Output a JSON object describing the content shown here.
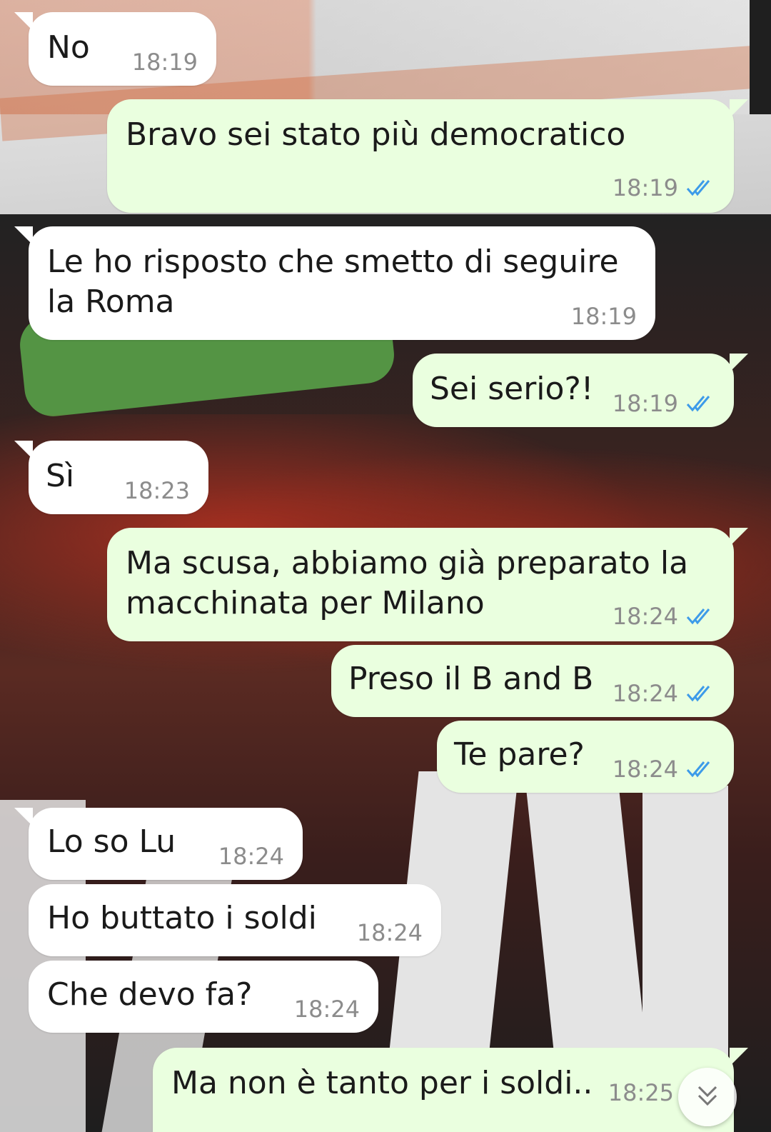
{
  "colors": {
    "incoming_bubble": "#ffffff",
    "outgoing_bubble": "#eaffdf",
    "read_ticks": "#3d9be9",
    "time_text": "#8c8c8c"
  },
  "icons": {
    "read_receipt": "double-check-icon",
    "scroll_down": "chevron-double-down-icon"
  },
  "messages": [
    {
      "dir": "in",
      "text": "No",
      "time": "18:19"
    },
    {
      "dir": "out",
      "text": "Bravo sei stato più democratico",
      "time": "18:19",
      "status": "read"
    },
    {
      "dir": "in",
      "text": "Le ho risposto che smetto di seguire\nla Roma",
      "time": "18:19"
    },
    {
      "dir": "out",
      "text": "Sei serio?!",
      "time": "18:19",
      "status": "read"
    },
    {
      "dir": "in",
      "text": "Sì",
      "time": "18:23"
    },
    {
      "dir": "out",
      "text": "Ma scusa, abbiamo già preparato la\nmacchinata per Milano",
      "time": "18:24",
      "status": "read"
    },
    {
      "dir": "out",
      "text": "Preso il B and B",
      "time": "18:24",
      "status": "read"
    },
    {
      "dir": "out",
      "text": "Te pare?",
      "time": "18:24",
      "status": "read"
    },
    {
      "dir": "in",
      "text": "Lo so Lu",
      "time": "18:24"
    },
    {
      "dir": "in",
      "text": "Ho buttato i soldi",
      "time": "18:24"
    },
    {
      "dir": "in",
      "text": "Che devo fa?",
      "time": "18:24"
    },
    {
      "dir": "out",
      "text": "Ma non è tanto per i soldi..",
      "time": "18:25",
      "status": "sent"
    }
  ]
}
